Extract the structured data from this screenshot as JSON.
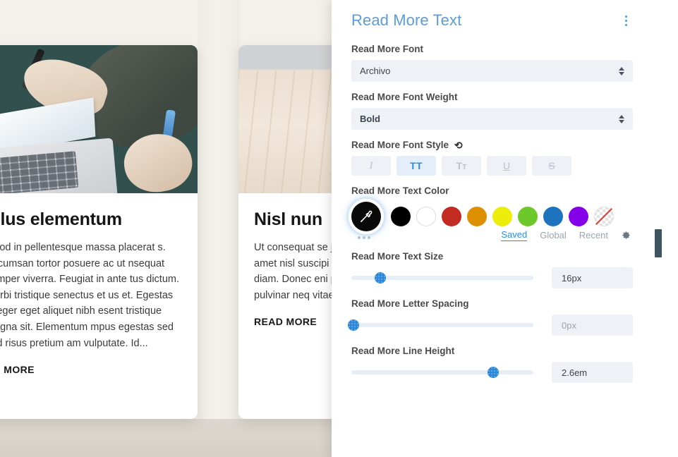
{
  "page": {
    "background_color": "#f4f1ec",
    "lower_band_color": "#dbd7cf"
  },
  "cards": [
    {
      "title": "ellus elementum",
      "image_alt": "person-writing-in-notebook-with-laptop",
      "body": "smod in pellentesque massa placerat s. Accumsan tortor posuere ac ut nsequat semper viverra. Feugiat in ante tus dictum. Morbi tristique senectus et us et. Egestas integer eget aliquet nibh esent tristique magna sit. Elementum mpus egestas sed sed risus pretium am vulputate. Id...",
      "read_more": "AD MORE"
    },
    {
      "title": "Nisl nun",
      "image_alt": "succulent-plant-on-wooden-desk-with-tablet",
      "body": "Ut consequat se justo laoreet sit a amet nisl suscipi est ultricies. Fer diam. Donec eni pharetra. Fermer non pulvinar neq vitae semper qui",
      "read_more": "READ MORE"
    }
  ],
  "panel": {
    "title": "Read More Text",
    "title_color": "#5b9dd9",
    "kebab_icon": "vertical-dots-icon",
    "font": {
      "label": "Read More Font",
      "value": "Archivo",
      "spinner_icon": "up-down-arrows-icon"
    },
    "font_weight": {
      "label": "Read More Font Weight",
      "value": "Bold",
      "spinner_icon": "up-down-arrows-icon"
    },
    "font_style": {
      "label": "Read More Font Style",
      "reset_icon": "undo-reset-icon",
      "buttons": [
        {
          "name": "italic",
          "glyph": "I",
          "active": false
        },
        {
          "name": "uppercase",
          "glyph": "TT",
          "active": true
        },
        {
          "name": "small-caps",
          "glyph": "T",
          "glyph_small": "T",
          "active": false
        },
        {
          "name": "underline",
          "glyph": "U",
          "active": false
        },
        {
          "name": "strikethrough",
          "glyph": "S",
          "active": false
        }
      ]
    },
    "text_color": {
      "label": "Read More Text Color",
      "picker_icon": "eyedropper-icon",
      "more_icon": "three-dots-icon",
      "selected": "#000000",
      "swatches": [
        {
          "name": "black",
          "hex": "#000000"
        },
        {
          "name": "white",
          "hex": "#FFFFFF"
        },
        {
          "name": "red",
          "hex": "#C32A20"
        },
        {
          "name": "orange",
          "hex": "#DD9000"
        },
        {
          "name": "yellow",
          "hex": "#EDED0B"
        },
        {
          "name": "green",
          "hex": "#6DC82A"
        },
        {
          "name": "blue",
          "hex": "#1E73BE"
        },
        {
          "name": "purple",
          "hex": "#8300E9"
        },
        {
          "name": "transparent",
          "hex": "transparent"
        }
      ],
      "tabs": [
        {
          "label": "Saved",
          "active": true
        },
        {
          "label": "Global",
          "active": false
        },
        {
          "label": "Recent",
          "active": false
        }
      ],
      "settings_icon": "gear-icon"
    },
    "text_size": {
      "label": "Read More Text Size",
      "value": "16px",
      "muted": false,
      "slider_percent": 16
    },
    "letter_spacing": {
      "label": "Read More Letter Spacing",
      "value": "0px",
      "muted": true,
      "slider_percent": 1
    },
    "line_height": {
      "label": "Read More Line Height",
      "value": "2.6em",
      "muted": false,
      "slider_percent": 78
    },
    "scrollbar": {
      "thumb_color": "#3d5461"
    }
  }
}
